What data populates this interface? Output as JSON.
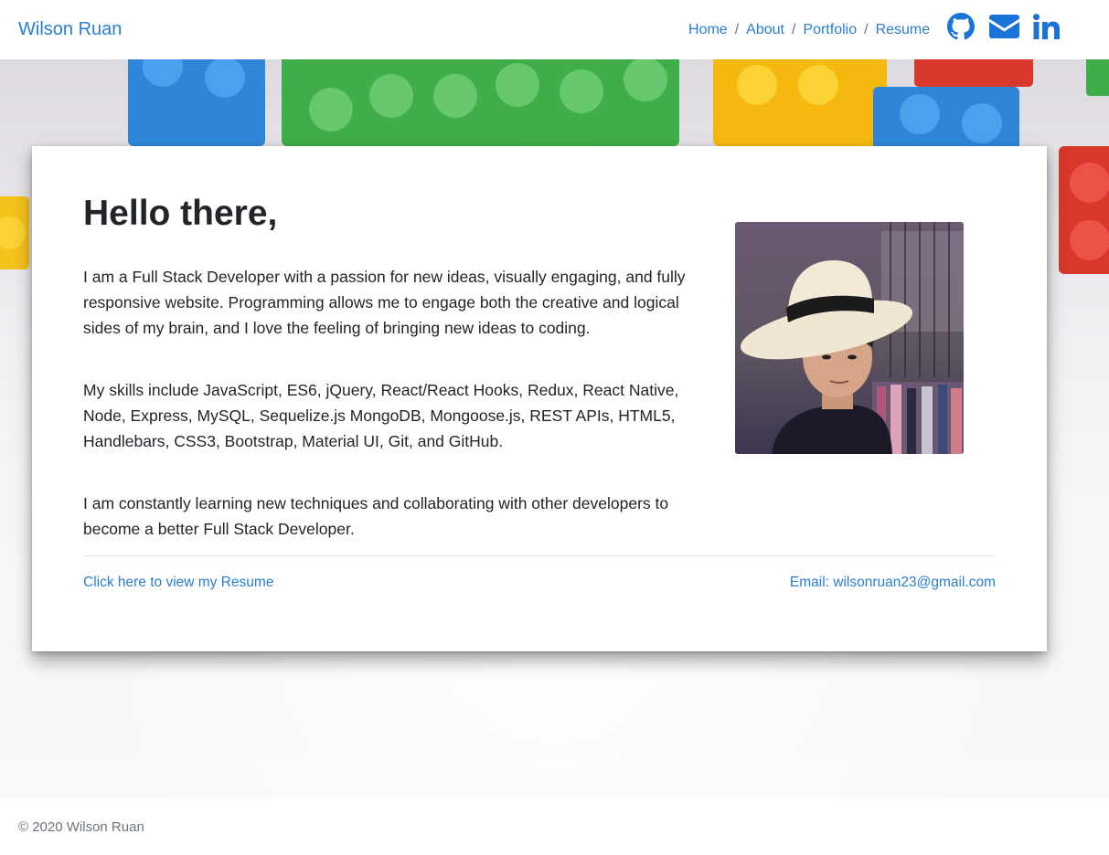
{
  "navbar": {
    "brand": "Wilson Ruan",
    "links": [
      {
        "label": "Home"
      },
      {
        "label": "About"
      },
      {
        "label": "Portfolio"
      },
      {
        "label": "Resume"
      }
    ],
    "separator": "/",
    "icons": [
      "github-icon",
      "envelope-icon",
      "linkedin-icon"
    ]
  },
  "about": {
    "greeting": "Hello there,",
    "paragraphs": [
      "I am a Full Stack Developer with a passion for new ideas, visually engaging, and fully responsive website. Programming allows me to engage both the creative and logical sides of my brain, and I love the feeling of bringing new ideas to coding.",
      "My skills include JavaScript, ES6, jQuery, React/React Hooks, Redux, React Native, Node, Express, MySQL, Sequelize.js MongoDB, Mongoose.js, REST APIs, HTML5, Handlebars, CSS3, Bootstrap, Material UI, Git, and GitHub.",
      "I am constantly learning new techniques and collaborating with other developers to become a better Full Stack Developer."
    ],
    "resume_link": "Click here to view my Resume",
    "email_link": "Email: wilsonruan23@gmail.com"
  },
  "footer": {
    "copyright": "© 2020 Wilson Ruan"
  },
  "colors": {
    "link": "#2a7ed2",
    "icon": "#1a73d9",
    "text": "#212529",
    "muted": "#6c757d"
  }
}
